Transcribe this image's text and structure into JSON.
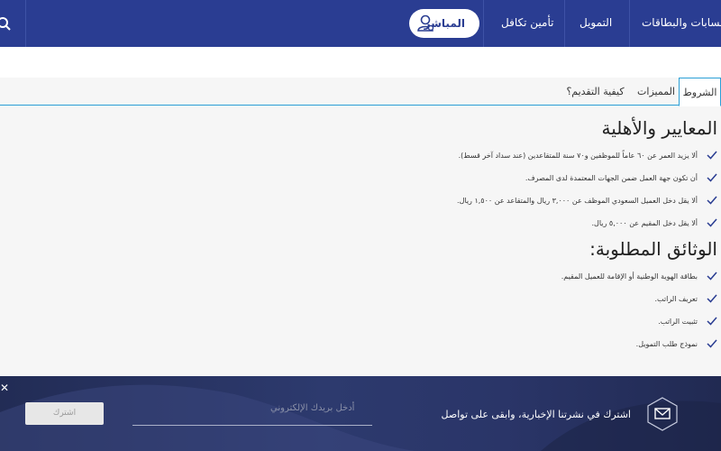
{
  "nav": {
    "items": [
      "الحسابات والبطاقات",
      "التمويل",
      "تأمين تكافل"
    ],
    "live_label": "المباشر"
  },
  "tabs": [
    "الشروط",
    "المميزات",
    "كيفية التقديم؟"
  ],
  "sections": {
    "criteria_title": "المعايير والأهلية",
    "criteria": [
      "ألا يزيد العمر عن ٦٠ عاماً للموظفين و٧٠ سنة للمتقاعدين (عند سداد آخر قسط).",
      "أن تكون جهة العمل ضمن الجهات المعتمدة لدى المصرف.",
      "ألا يقل دخل العميل السعودي الموظف عن ٣,٠٠٠ ريال والمتقاعد عن ١,٥٠٠ ريال.",
      "ألا يقل دخل المقيم عن ٥,٠٠٠ ريال."
    ],
    "documents_title": "الوثائق المطلوبة:",
    "documents": [
      "بطاقة الهوية الوطنية أو الإقامة للعميل المقيم.",
      "تعريف الراتب.",
      "تثبيت الراتب.",
      "نموذج طلب التمويل."
    ]
  },
  "footer": {
    "newsletter_text": "اشترك في نشرتنا الإخبارية، وابقى على تواصل",
    "email_placeholder": "أدخل بريدك الإلكتروني",
    "subscribe_label": "اشترك",
    "close_label": "✕"
  },
  "colors": {
    "nav_bg": "#2a3d92",
    "accent": "#2a9fd6",
    "footer_bg": "#2d3a6e"
  }
}
